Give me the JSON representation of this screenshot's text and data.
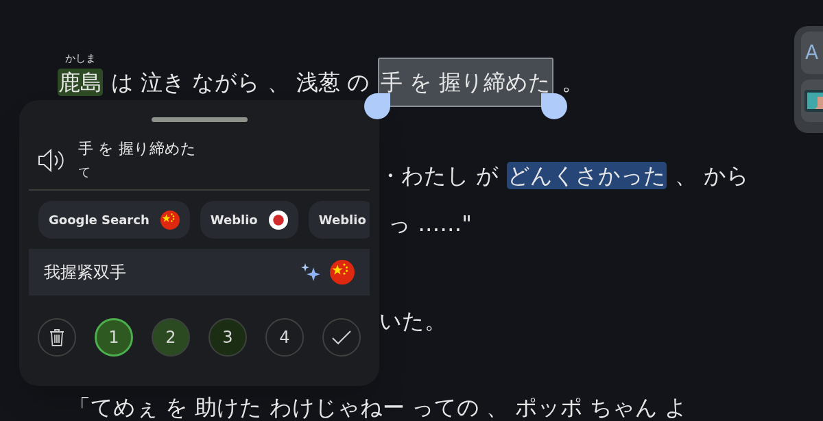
{
  "reader": {
    "lines": [
      {
        "segments": [
          {
            "text": "鹿島",
            "ruby": "かしま",
            "kind": "known"
          },
          {
            "text": "は 泣き ながら 、 浅葱 の",
            "kind": "plain"
          },
          {
            "text": "手 を 握り締めた",
            "kind": "selected"
          },
          {
            "text": "。",
            "kind": "plain"
          }
        ]
      },
      {
        "segments": [
          {
            "text": "・わたし が",
            "kind": "plain"
          },
          {
            "text": "どんくさかった",
            "kind": "lookup"
          },
          {
            "text": "、 から",
            "kind": "plain"
          }
        ]
      },
      {
        "segments": [
          {
            "text": "っ ……\"",
            "kind": "plain"
          }
        ]
      },
      {
        "segments": [
          {
            "text": "いた。",
            "kind": "plain"
          }
        ]
      },
      {
        "segments": [
          {
            "text": "「てめぇ を 助けた わけじゃねー っての 、 ポッポ ちゃん よ",
            "kind": "plain"
          }
        ]
      }
    ]
  },
  "popup": {
    "sentence": "手 を 握り締めた",
    "reading": "て",
    "dictionaries": [
      {
        "label": "Google Search",
        "kind": "chinese"
      },
      {
        "label": "Weblio",
        "kind": "japanese"
      },
      {
        "label": "Weblio",
        "kind": "plain"
      }
    ],
    "translation": {
      "text": "我握紧双手"
    },
    "ratings": [
      {
        "kind": "delete",
        "selected": false
      },
      {
        "kind": "grade",
        "label": "1",
        "color": "#2e5a22",
        "selected": true
      },
      {
        "kind": "grade",
        "label": "2",
        "color": "#2b4a21",
        "selected": false
      },
      {
        "kind": "grade",
        "label": "3",
        "color": "#1b2e14",
        "selected": false
      },
      {
        "kind": "grade",
        "label": "4",
        "color": "#1b1d21",
        "selected": false
      },
      {
        "kind": "confirm",
        "selected": false
      }
    ]
  },
  "side_panel": {
    "label": "A"
  }
}
